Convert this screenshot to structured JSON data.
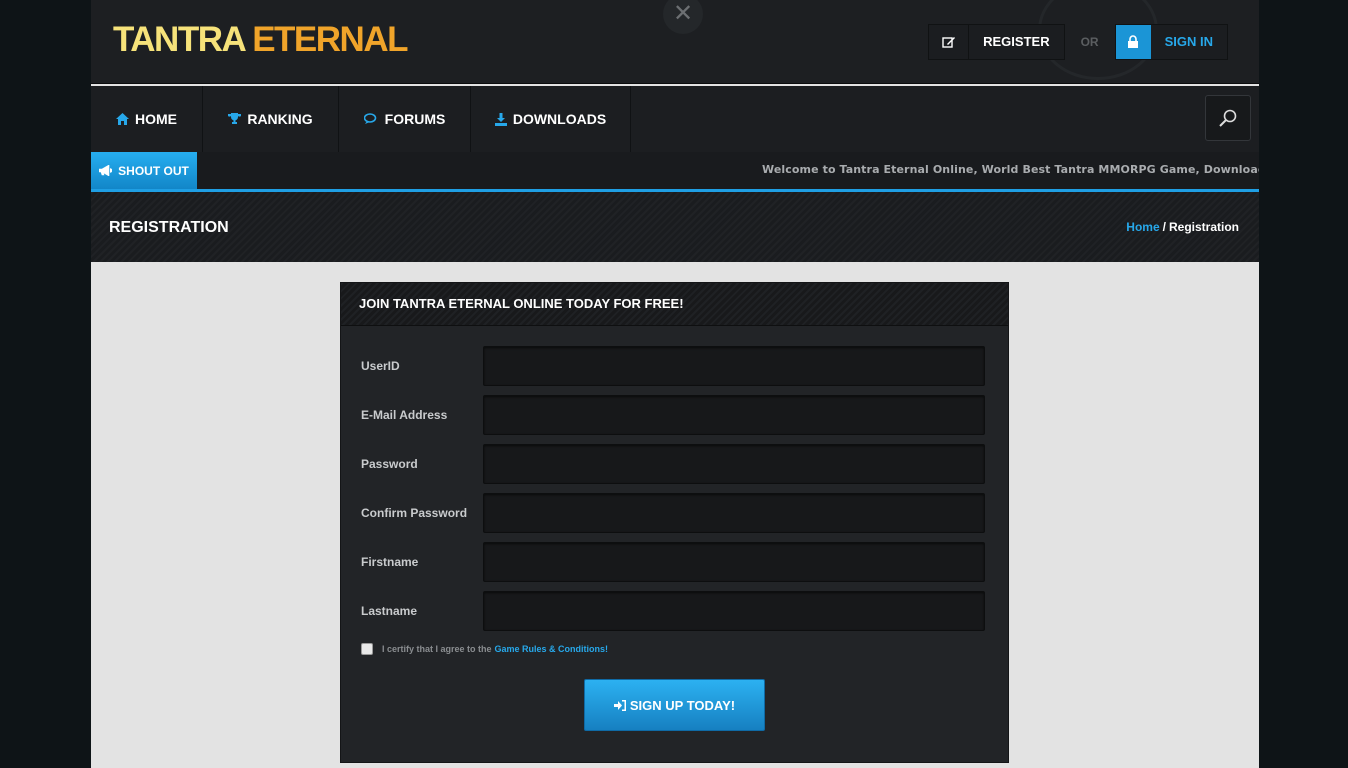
{
  "logo": {
    "part1": "TANTRA",
    "part2": "ETERNAL"
  },
  "header": {
    "close_glyph": "✕",
    "register_label": "REGISTER",
    "or_label": "OR",
    "signin_label": "SIGN IN",
    "register_icon": "edit-icon",
    "signin_icon": "lock-icon"
  },
  "nav": {
    "items": [
      {
        "label": "HOME",
        "icon": "home-icon"
      },
      {
        "label": "RANKING",
        "icon": "trophy-icon"
      },
      {
        "label": "FORUMS",
        "icon": "comments-icon"
      },
      {
        "label": "DOWNLOADS",
        "icon": "download-icon"
      }
    ],
    "search_icon": "search-icon"
  },
  "shout": {
    "label": "SHOUT OUT",
    "text": "Welcome to Tantra Eternal Online, World Best Tantra MMORPG Game, Download and Cre"
  },
  "page": {
    "title": "REGISTRATION",
    "breadcrumb": {
      "home": "Home",
      "separator": "/",
      "current": "Registration"
    }
  },
  "form": {
    "heading": "JOIN TANTRA ETERNAL ONLINE TODAY FOR FREE!",
    "fields": [
      {
        "label": "UserID",
        "value": ""
      },
      {
        "label": "E-Mail Address",
        "value": ""
      },
      {
        "label": "Password",
        "value": ""
      },
      {
        "label": "Confirm Password",
        "value": ""
      },
      {
        "label": "Firstname",
        "value": ""
      },
      {
        "label": "Lastname",
        "value": ""
      }
    ],
    "agree_text": "I certify that I agree to the",
    "agree_link": "Game Rules & Conditions!",
    "submit_label": "SIGN UP TODAY!"
  },
  "colors": {
    "accent": "#27a8ea",
    "logo_primary": "#f6e27a",
    "logo_secondary": "#f0a42a",
    "panel_bg": "#222427",
    "page_bg": "#e3e3e3"
  }
}
